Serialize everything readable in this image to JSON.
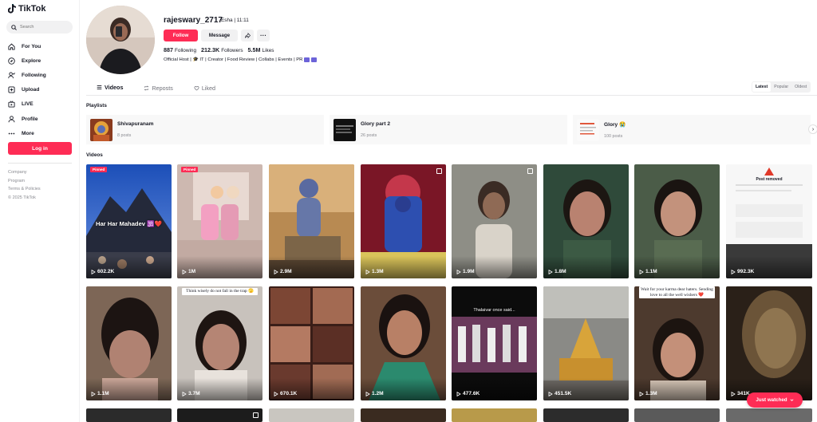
{
  "app": {
    "name": "TikTok"
  },
  "search": {
    "placeholder": "Search"
  },
  "nav": [
    {
      "label": "For You",
      "icon": "home-icon"
    },
    {
      "label": "Explore",
      "icon": "compass-icon"
    },
    {
      "label": "Following",
      "icon": "following-icon"
    },
    {
      "label": "Upload",
      "icon": "upload-icon"
    },
    {
      "label": "LIVE",
      "icon": "live-icon"
    },
    {
      "label": "Profile",
      "icon": "profile-icon"
    },
    {
      "label": "More",
      "icon": "more-icon"
    }
  ],
  "login_label": "Log in",
  "footer": [
    "Company",
    "Program",
    "Terms & Policies",
    "© 2025 TikTok"
  ],
  "profile": {
    "username": "rajeswary_2717",
    "display": "Esha | 11:11",
    "follow_label": "Follow",
    "message_label": "Message",
    "more_label": "···",
    "following_count": "887",
    "following_label": "Following",
    "followers_count": "212.3K",
    "followers_label": "Followers",
    "likes_count": "5.5M",
    "likes_label": "Likes",
    "bio": "Official Host | 🎓 IT | Creator | Food Review | Collabs | Events | PR"
  },
  "tabs": [
    {
      "label": "Videos",
      "icon": "grid-icon"
    },
    {
      "label": "Reposts",
      "icon": "repost-icon"
    },
    {
      "label": "Liked",
      "icon": "heart-outline-icon"
    }
  ],
  "sort": [
    "Latest",
    "Popular",
    "Oldest"
  ],
  "playlists_title": "Playlists",
  "playlists": [
    {
      "name": "Shivapuranam",
      "count": "8 posts"
    },
    {
      "name": "Glory part 2",
      "count": "26 posts"
    },
    {
      "name": "Glory 😭",
      "count": "100 posts"
    }
  ],
  "videos_title": "Videos",
  "videos": [
    {
      "views": "602.2K",
      "pinned": "Pinned",
      "caption": "Har Har Mahadev 🕉️❤️"
    },
    {
      "views": "1M",
      "pinned": "Pinned"
    },
    {
      "views": "2.9M"
    },
    {
      "views": "1.3M"
    },
    {
      "views": "1.9M"
    },
    {
      "views": "1.8M"
    },
    {
      "views": "1.1M"
    },
    {
      "views": "992.3K",
      "caption": "Post removed"
    },
    {
      "views": "1.1M"
    },
    {
      "views": "3.7M",
      "caption": "Think wisely do not fall in the trap 🫣"
    },
    {
      "views": "670.1K"
    },
    {
      "views": "1.2M"
    },
    {
      "views": "477.6K",
      "caption": "Thalaivar once said..."
    },
    {
      "views": "451.5K"
    },
    {
      "views": "1.3M",
      "caption": "Wait for your karma dear haters. Sending love to all the well wishers ❤️"
    },
    {
      "views": "341K"
    }
  ],
  "just_watched_label": "Just watched",
  "colors": {
    "accent": "#fe2c55",
    "text": "#161823",
    "muted": "#8a8b91"
  }
}
